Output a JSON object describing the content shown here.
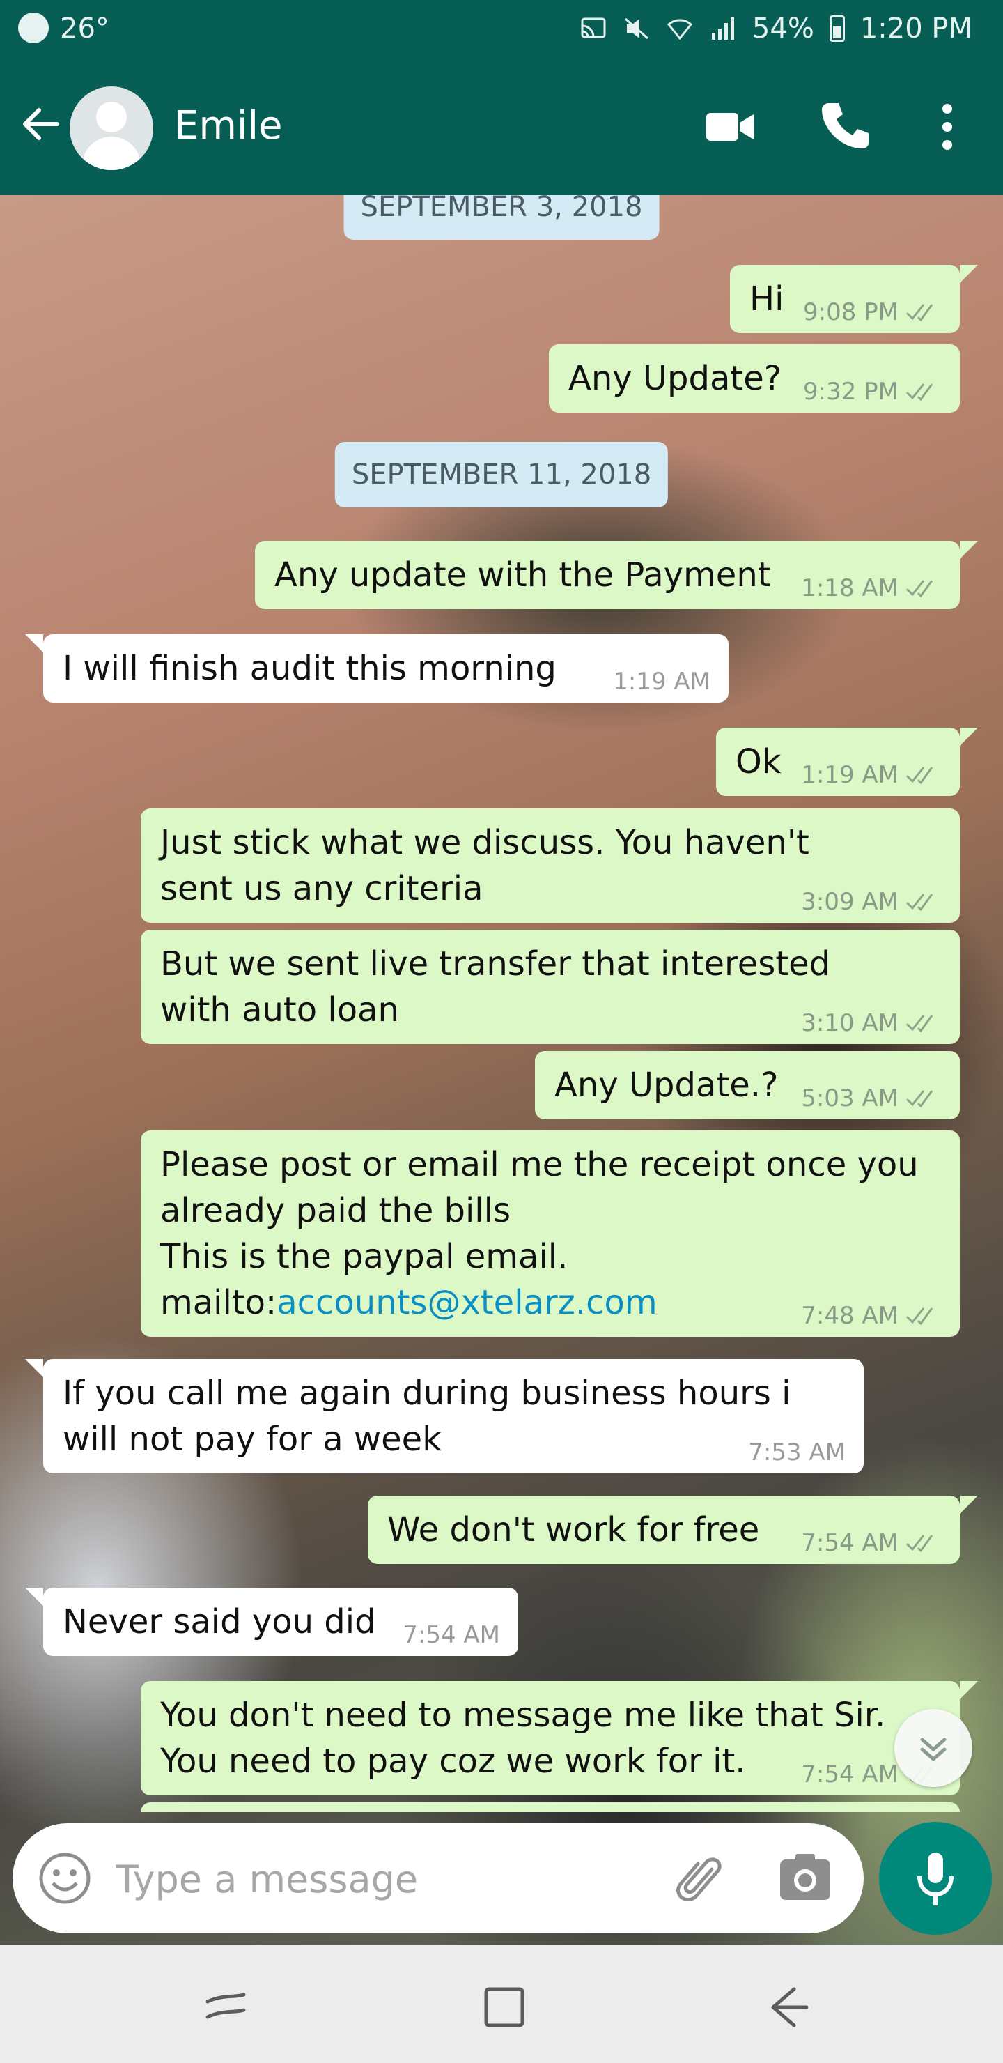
{
  "status_bar": {
    "temperature": "26°",
    "battery": "54%",
    "time": "1:20 PM"
  },
  "header": {
    "contact_name": "Emile",
    "icons": [
      "back-arrow-icon",
      "avatar",
      "video-call-icon",
      "phone-icon",
      "more-vert-icon"
    ]
  },
  "chat": {
    "date_chips": [
      "SEPTEMBER 3, 2018",
      "SEPTEMBER 11, 2018"
    ],
    "messages": [
      {
        "dir": "out",
        "text": "Hi",
        "time": "9:08 PM"
      },
      {
        "dir": "out",
        "text": "Any Update?",
        "time": "9:32 PM"
      },
      {
        "dir": "out",
        "text": "Any update with the Payment",
        "time": "1:18 AM"
      },
      {
        "dir": "in",
        "text": "I will finish audit this morning",
        "time": "1:19 AM"
      },
      {
        "dir": "out",
        "text": "Ok",
        "time": "1:19 AM"
      },
      {
        "dir": "out",
        "text": "Just stick what we discuss. You haven't\nsent us any criteria",
        "time": "3:09 AM"
      },
      {
        "dir": "out",
        "text": "But we sent live transfer that interested\nwith auto loan",
        "time": "3:10 AM"
      },
      {
        "dir": "out",
        "text": "Any Update.?",
        "time": "5:03 AM"
      },
      {
        "dir": "out",
        "text_main": "Please post or email me the receipt once you\nalready paid the bills\nThis is the paypal email.\nmailto:",
        "link": "accounts@xtelarz.com",
        "time": "7:48 AM"
      },
      {
        "dir": "in",
        "text": "If you call me again during business hours i\nwill not pay for a week",
        "time": "7:53 AM"
      },
      {
        "dir": "out",
        "text": "We don't work for free",
        "time": "7:54 AM"
      },
      {
        "dir": "in",
        "text": "Never said you did",
        "time": "7:54 AM"
      },
      {
        "dir": "out",
        "text": "You don't need to message me like that Sir.\nYou need to pay coz we work for it.",
        "time": "7:54 AM"
      }
    ]
  },
  "composer": {
    "placeholder": "Type a message"
  },
  "colors": {
    "header": "#075e54",
    "outgoing_bubble": "#dcf8c6",
    "incoming_bubble": "#ffffff",
    "date_chip": "#d4eaf4",
    "mic_button": "#00897b"
  }
}
